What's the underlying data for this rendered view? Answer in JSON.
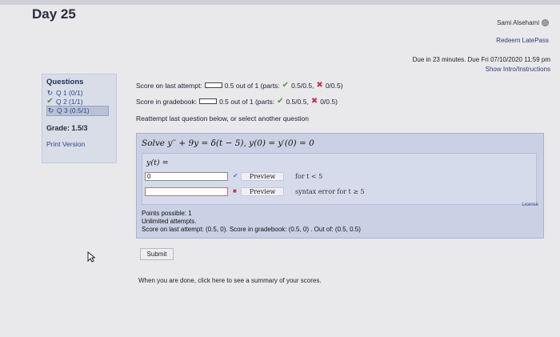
{
  "page": {
    "title": "Day 25"
  },
  "header": {
    "user": "Sami Alsehami",
    "redeem": "Redeem LatePass",
    "due": "Due in 23 minutes. Due Fri 07/10/2020 11:59 pm",
    "intro": "Show Intro/Instructions"
  },
  "sidebar": {
    "title": "Questions",
    "items": [
      {
        "label": "Q 1 (0/1)",
        "status": "retry"
      },
      {
        "label": "Q 2 (1/1)",
        "status": "correct"
      },
      {
        "label": "Q 3 (0.5/1)",
        "status": "retry"
      }
    ],
    "grade": "Grade: 1.5/3",
    "print": "Print Version"
  },
  "meta": {
    "last_label": "Score on last attempt:",
    "last_text": "0.5 out of 1 (parts:",
    "last_p1": "0.5/0.5,",
    "last_p2": "0/0.5)",
    "grade_label": "Score in gradebook:",
    "grade_text": "0.5 out of 1 (parts:",
    "grade_p1": "0.5/0.5,",
    "grade_p2": "0/0.5)",
    "reattempt": "Reattempt last question below, or select another question"
  },
  "question": {
    "prompt": "Solve y′′ + 9y = δ(t − 5),  y(0) = y′(0) = 0",
    "answer_label": "y(t) =",
    "inputs": [
      {
        "value": "0",
        "preview_label": "Preview",
        "cond": "for t < 5",
        "status": "ok"
      },
      {
        "value": "",
        "preview_label": "Preview",
        "cond": "syntax error for t ≥ 5",
        "status": "error"
      }
    ],
    "license": "License",
    "points": "Points possible: 1",
    "attempts": "Unlimited attempts.",
    "score_line": "Score on last attempt: (0.5, 0). Score in gradebook: (0.5, 0) . Out of: (0.5, 0.5)"
  },
  "submit_label": "Submit",
  "summary": "When you are done, click here to see a summary of your scores."
}
